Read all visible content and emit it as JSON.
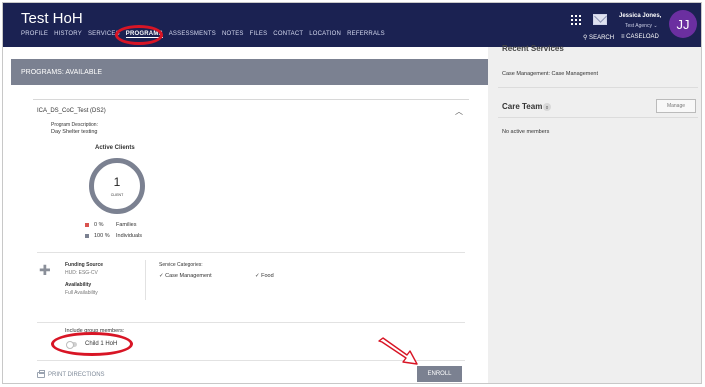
{
  "header": {
    "title": "Test HoH",
    "nav": [
      "PROFILE",
      "HISTORY",
      "SERVICES",
      "PROGRAMS",
      "ASSESSMENTS",
      "NOTES",
      "FILES",
      "CONTACT",
      "LOCATION",
      "REFERRALS"
    ],
    "active_nav": "PROGRAMS",
    "user_name": "Jessica Jones,",
    "agency": "Test Agency ⌄",
    "avatar_initials": "JJ",
    "search_label": "⚲ SEARCH",
    "caseload_label": "≡ CASELOAD"
  },
  "main": {
    "section_title": "PROGRAMS: AVAILABLE",
    "program": {
      "name": "ICA_DS_CoC_Test (DS2)",
      "description_label": "Program Description:",
      "description": "Day Shelter testing",
      "active_clients_title": "Active Clients",
      "client_count": "1",
      "client_count_label": "CLIENT",
      "legend": [
        {
          "pct": "0 %",
          "label": "Families",
          "color": "#d9534f"
        },
        {
          "pct": "100 %",
          "label": "Individuals",
          "color": "#7b8191"
        }
      ],
      "funding_label": "Funding Source",
      "funding_value": "HUD: ESG-CV",
      "availability_label": "Availability",
      "availability_value": "Full Availability",
      "service_categories_label": "Service Categories:",
      "service_categories": [
        "✓  Case Management",
        "✓  Food"
      ],
      "group_members_label": "Include group members:",
      "group_member": "Child 1 HoH"
    },
    "print_label": "PRINT DIRECTIONS",
    "enroll_label": "ENROLL"
  },
  "side": {
    "recent_title": "Recent Services",
    "recent_item": "Case Management: Case Management",
    "care_team_title": "Care Team",
    "care_team_count": "0",
    "manage_label": "Manage",
    "care_team_empty": "No active members"
  },
  "colors": {
    "header_bg": "#1b2252",
    "banner_bg": "#7b8191",
    "annotation_red": "#d81525",
    "avatar_bg": "#6b2fa0"
  }
}
